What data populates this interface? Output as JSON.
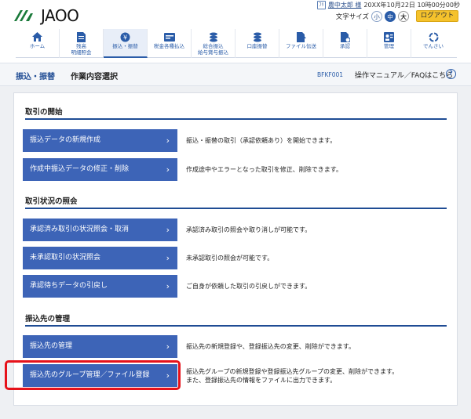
{
  "header": {
    "logo_text": "JAOO",
    "user_icon": "ﾌﾘ",
    "user_name": "農中太郎 様",
    "login_time": "20XX年10月22日 10時00分00秒",
    "font_size_label": "文字サイズ",
    "font_sizes": [
      "小",
      "中",
      "大"
    ],
    "logout_label": "ログアウト",
    "brand_color": "#2a5ca8",
    "logout_color": "#f5c22c"
  },
  "nav": {
    "items": [
      {
        "label": "ホーム",
        "icon": "home-icon"
      },
      {
        "label": "残高\n明細照会",
        "icon": "document-icon"
      },
      {
        "label": "振込・振替",
        "icon": "transfer-icon"
      },
      {
        "label": "税金各種払込",
        "icon": "payment-icon"
      },
      {
        "label": "総合振込\n給与賞与振込",
        "icon": "coins-icon"
      },
      {
        "label": "口座振替",
        "icon": "coins-icon"
      },
      {
        "label": "ファイル伝送",
        "icon": "file-icon"
      },
      {
        "label": "承認",
        "icon": "approve-icon"
      },
      {
        "label": "管理",
        "icon": "admin-icon"
      },
      {
        "label": "でんさい",
        "icon": "densai-icon"
      }
    ],
    "active_index": 2
  },
  "titlebar": {
    "breadcrumb": "振込・振替",
    "page_title": "作業内容選択",
    "screen_id": "BFKF001",
    "manual_link": "操作マニュアル／FAQはこちら",
    "help_icon": "?"
  },
  "sections": [
    {
      "title": "取引の開始",
      "actions": [
        {
          "label": "振込データの新規作成",
          "desc": "振込・振替の取引（承認依頼あり）を開始できます。"
        },
        {
          "label": "作成中振込データの修正・削除",
          "desc": "作成途中やエラーとなった取引を修正、削除できます。"
        }
      ]
    },
    {
      "title": "取引状況の照会",
      "actions": [
        {
          "label": "承認済み取引の状況照会・取消",
          "desc": "承認済み取引の照会や取り消しが可能です。"
        },
        {
          "label": "未承認取引の状況照会",
          "desc": "未承認取引の照会が可能です。"
        },
        {
          "label": "承認待ちデータの引戻し",
          "desc": "ご自身が依頼した取引の引戻しができます。"
        }
      ]
    },
    {
      "title": "振込先の管理",
      "actions": [
        {
          "label": "振込先の管理",
          "desc": "振込先の新規登録や、登録振込先の変更、削除ができます。"
        },
        {
          "label": "振込先のグループ管理／ファイル登録",
          "desc": "振込先グループの新規登録や登録振込先グループの変更、削除ができます。",
          "desc2": "また、登録振込先の情報をファイルに出力できます。"
        }
      ]
    }
  ],
  "chevron": "›"
}
